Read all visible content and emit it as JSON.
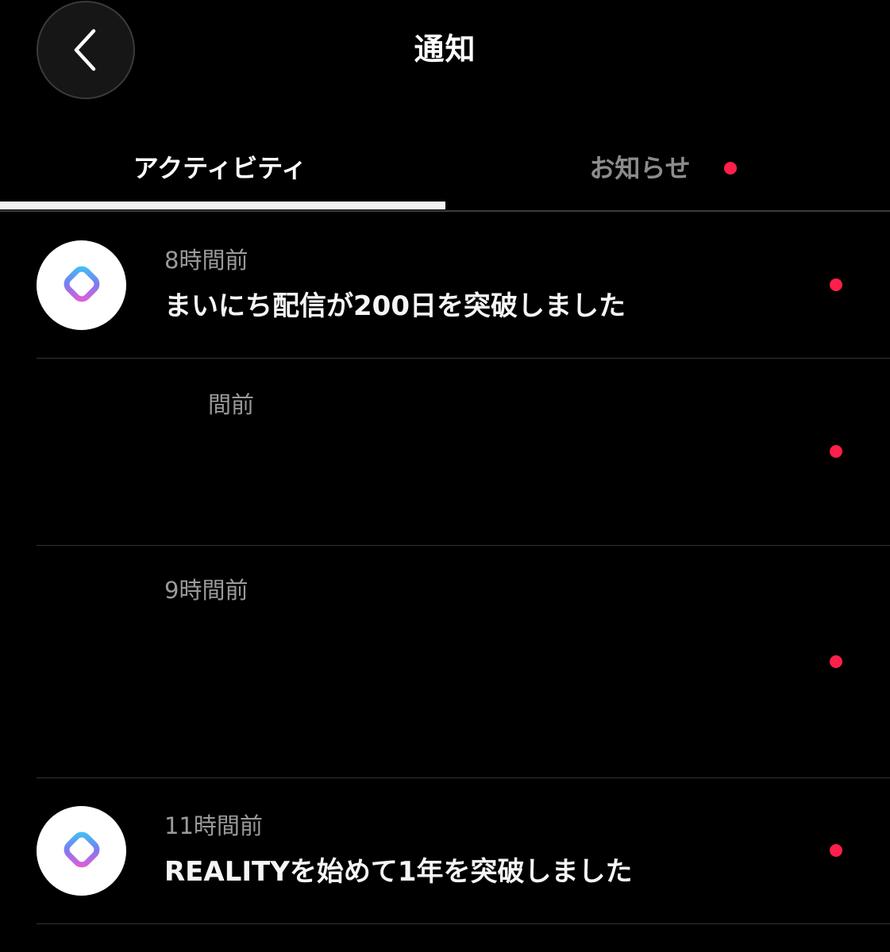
{
  "header": {
    "title": "通知",
    "back_icon": "chevron-left-icon"
  },
  "tabs": [
    {
      "label": "アクティビティ",
      "active": true
    },
    {
      "label": "お知らせ",
      "active": false,
      "has_unread": true
    }
  ],
  "notifications": [
    {
      "time": "8時間前",
      "message": "まいにち配信が200日を突破しました",
      "unread": true,
      "icon": "reality-logo-icon"
    },
    {
      "time": "間前",
      "message": "",
      "unread": true,
      "icon": ""
    },
    {
      "time": "9時間前",
      "message": "",
      "unread": true,
      "icon": ""
    },
    {
      "time": "11時間前",
      "message": "REALITYを始めて1年を突破しました",
      "unread": true,
      "icon": "reality-logo-icon"
    }
  ],
  "colors": {
    "background": "#000000",
    "unread_dot": "#ff1f4b",
    "tab_indicator": "#f2f2f2",
    "inactive_tab": "#8c8c8c",
    "timestamp": "#9a9a9a"
  }
}
